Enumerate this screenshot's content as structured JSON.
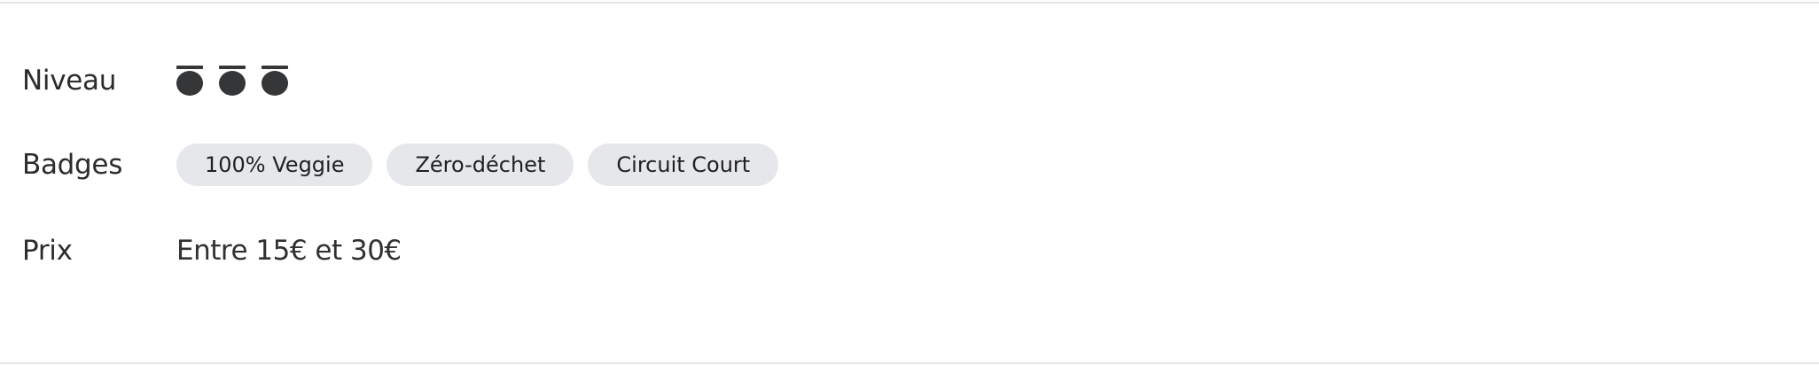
{
  "details": {
    "level": {
      "label": "Niveau",
      "value": 3,
      "max": 3,
      "icon": "chef-hat-icon",
      "icon_color": "#343638"
    },
    "badges": {
      "label": "Badges",
      "items": [
        "100% Veggie",
        "Zéro-déchet",
        "Circuit Court"
      ],
      "badge_bg": "#e6e7ea"
    },
    "price": {
      "label": "Prix",
      "value": "Entre 15€ et 30€"
    }
  }
}
